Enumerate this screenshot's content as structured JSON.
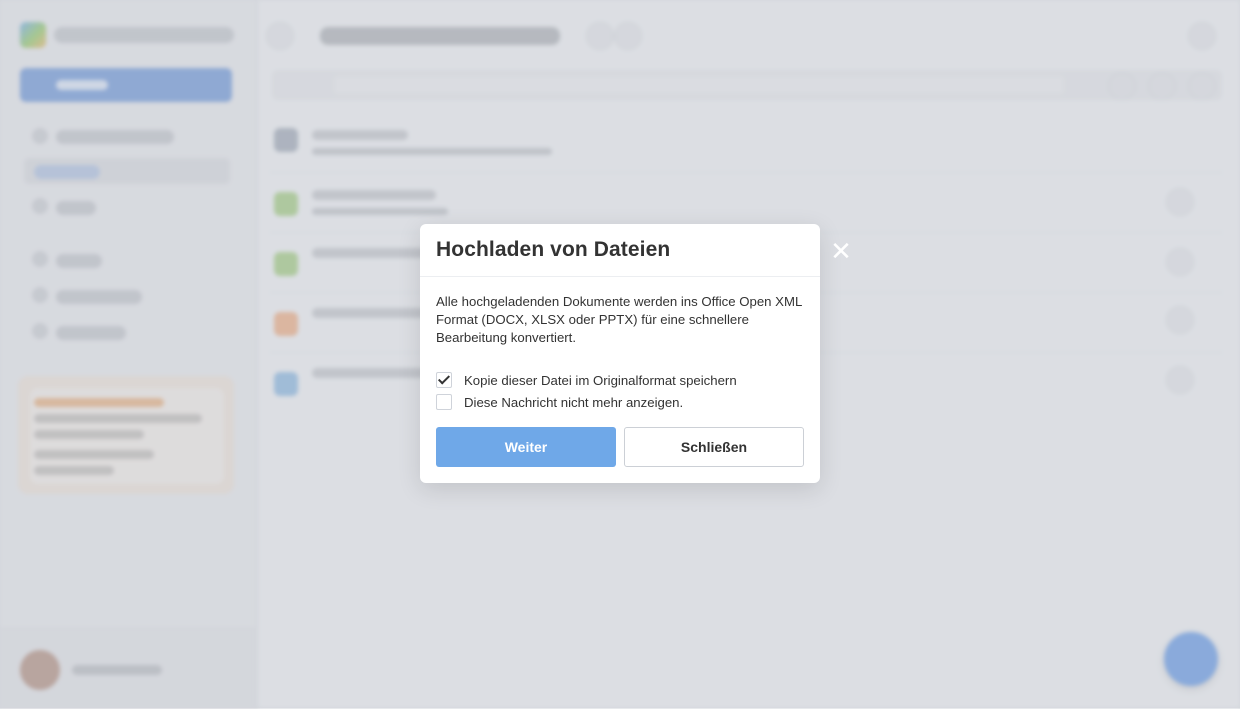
{
  "dialog": {
    "title": "Hochladen von Dateien",
    "description": "Alle hochgeladenden Dokumente werden ins Office Open XML Format (DOCX, XLSX oder PPTX) für eine schnellere Bearbeitung konvertiert.",
    "checkboxes": [
      {
        "label": "Kopie dieser Datei im Originalformat speichern",
        "checked": true
      },
      {
        "label": "Diese Nachricht nicht mehr anzeigen.",
        "checked": false
      }
    ],
    "primary_button": "Weiter",
    "secondary_button": "Schließen",
    "close_icon": "close-icon",
    "close_glyph": "✕"
  },
  "colors": {
    "primary_button": "#6fa8e8",
    "accent_blue": "#3e82e5",
    "text": "#333333"
  }
}
